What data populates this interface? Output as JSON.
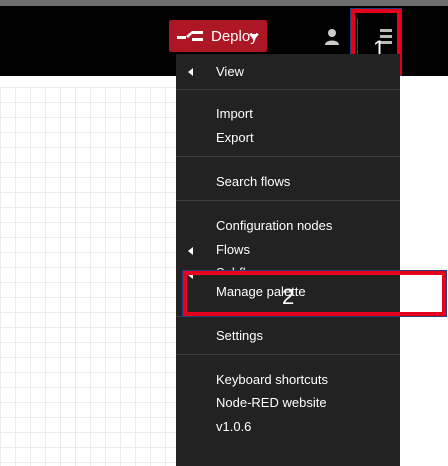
{
  "header": {
    "deploy_label": "Deploy"
  },
  "callouts": {
    "one": "1",
    "two": "2"
  },
  "menu": {
    "items": [
      {
        "label": "View"
      },
      {
        "label": "Import"
      },
      {
        "label": "Export"
      },
      {
        "label": "Search flows"
      },
      {
        "label": "Configuration nodes"
      },
      {
        "label": "Flows"
      },
      {
        "label": "Subflows"
      },
      {
        "label": "Manage palette"
      },
      {
        "label": "Settings"
      },
      {
        "label": "Keyboard shortcuts"
      },
      {
        "label": "Node-RED website"
      },
      {
        "label": "v1.0.6"
      }
    ]
  },
  "colors": {
    "header_bg": "#000000",
    "deploy_bg": "#ad1625",
    "menu_bg": "#222222",
    "highlight": "#e5001c"
  },
  "icons": {
    "deploy": "deploy-icon",
    "user": "user-icon",
    "menu": "hamburger-icon",
    "submenu": "chevron-left-icon"
  }
}
